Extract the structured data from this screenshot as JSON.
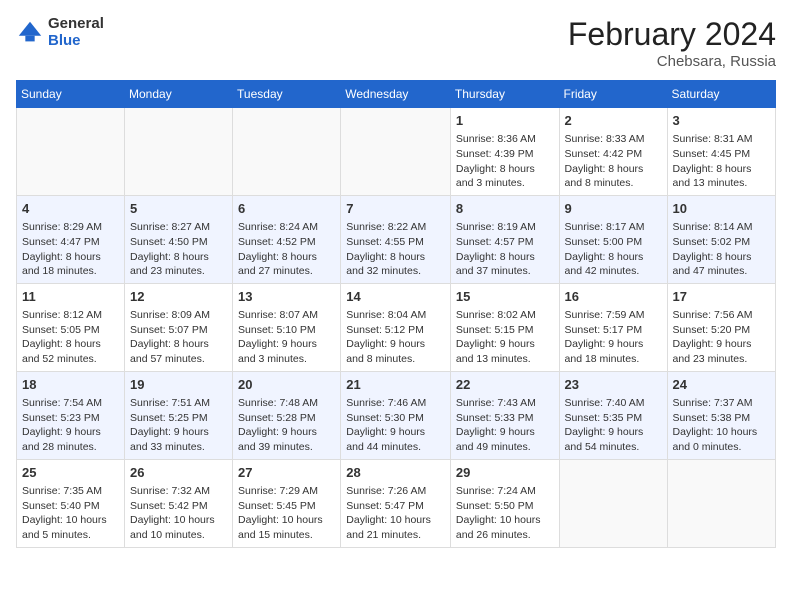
{
  "logo": {
    "general": "General",
    "blue": "Blue"
  },
  "title": {
    "month_year": "February 2024",
    "location": "Chebsara, Russia"
  },
  "weekdays": [
    "Sunday",
    "Monday",
    "Tuesday",
    "Wednesday",
    "Thursday",
    "Friday",
    "Saturday"
  ],
  "weeks": [
    [
      {
        "day": "",
        "text": ""
      },
      {
        "day": "",
        "text": ""
      },
      {
        "day": "",
        "text": ""
      },
      {
        "day": "",
        "text": ""
      },
      {
        "day": "1",
        "text": "Sunrise: 8:36 AM\nSunset: 4:39 PM\nDaylight: 8 hours\nand 3 minutes."
      },
      {
        "day": "2",
        "text": "Sunrise: 8:33 AM\nSunset: 4:42 PM\nDaylight: 8 hours\nand 8 minutes."
      },
      {
        "day": "3",
        "text": "Sunrise: 8:31 AM\nSunset: 4:45 PM\nDaylight: 8 hours\nand 13 minutes."
      }
    ],
    [
      {
        "day": "4",
        "text": "Sunrise: 8:29 AM\nSunset: 4:47 PM\nDaylight: 8 hours\nand 18 minutes."
      },
      {
        "day": "5",
        "text": "Sunrise: 8:27 AM\nSunset: 4:50 PM\nDaylight: 8 hours\nand 23 minutes."
      },
      {
        "day": "6",
        "text": "Sunrise: 8:24 AM\nSunset: 4:52 PM\nDaylight: 8 hours\nand 27 minutes."
      },
      {
        "day": "7",
        "text": "Sunrise: 8:22 AM\nSunset: 4:55 PM\nDaylight: 8 hours\nand 32 minutes."
      },
      {
        "day": "8",
        "text": "Sunrise: 8:19 AM\nSunset: 4:57 PM\nDaylight: 8 hours\nand 37 minutes."
      },
      {
        "day": "9",
        "text": "Sunrise: 8:17 AM\nSunset: 5:00 PM\nDaylight: 8 hours\nand 42 minutes."
      },
      {
        "day": "10",
        "text": "Sunrise: 8:14 AM\nSunset: 5:02 PM\nDaylight: 8 hours\nand 47 minutes."
      }
    ],
    [
      {
        "day": "11",
        "text": "Sunrise: 8:12 AM\nSunset: 5:05 PM\nDaylight: 8 hours\nand 52 minutes."
      },
      {
        "day": "12",
        "text": "Sunrise: 8:09 AM\nSunset: 5:07 PM\nDaylight: 8 hours\nand 57 minutes."
      },
      {
        "day": "13",
        "text": "Sunrise: 8:07 AM\nSunset: 5:10 PM\nDaylight: 9 hours\nand 3 minutes."
      },
      {
        "day": "14",
        "text": "Sunrise: 8:04 AM\nSunset: 5:12 PM\nDaylight: 9 hours\nand 8 minutes."
      },
      {
        "day": "15",
        "text": "Sunrise: 8:02 AM\nSunset: 5:15 PM\nDaylight: 9 hours\nand 13 minutes."
      },
      {
        "day": "16",
        "text": "Sunrise: 7:59 AM\nSunset: 5:17 PM\nDaylight: 9 hours\nand 18 minutes."
      },
      {
        "day": "17",
        "text": "Sunrise: 7:56 AM\nSunset: 5:20 PM\nDaylight: 9 hours\nand 23 minutes."
      }
    ],
    [
      {
        "day": "18",
        "text": "Sunrise: 7:54 AM\nSunset: 5:23 PM\nDaylight: 9 hours\nand 28 minutes."
      },
      {
        "day": "19",
        "text": "Sunrise: 7:51 AM\nSunset: 5:25 PM\nDaylight: 9 hours\nand 33 minutes."
      },
      {
        "day": "20",
        "text": "Sunrise: 7:48 AM\nSunset: 5:28 PM\nDaylight: 9 hours\nand 39 minutes."
      },
      {
        "day": "21",
        "text": "Sunrise: 7:46 AM\nSunset: 5:30 PM\nDaylight: 9 hours\nand 44 minutes."
      },
      {
        "day": "22",
        "text": "Sunrise: 7:43 AM\nSunset: 5:33 PM\nDaylight: 9 hours\nand 49 minutes."
      },
      {
        "day": "23",
        "text": "Sunrise: 7:40 AM\nSunset: 5:35 PM\nDaylight: 9 hours\nand 54 minutes."
      },
      {
        "day": "24",
        "text": "Sunrise: 7:37 AM\nSunset: 5:38 PM\nDaylight: 10 hours\nand 0 minutes."
      }
    ],
    [
      {
        "day": "25",
        "text": "Sunrise: 7:35 AM\nSunset: 5:40 PM\nDaylight: 10 hours\nand 5 minutes."
      },
      {
        "day": "26",
        "text": "Sunrise: 7:32 AM\nSunset: 5:42 PM\nDaylight: 10 hours\nand 10 minutes."
      },
      {
        "day": "27",
        "text": "Sunrise: 7:29 AM\nSunset: 5:45 PM\nDaylight: 10 hours\nand 15 minutes."
      },
      {
        "day": "28",
        "text": "Sunrise: 7:26 AM\nSunset: 5:47 PM\nDaylight: 10 hours\nand 21 minutes."
      },
      {
        "day": "29",
        "text": "Sunrise: 7:24 AM\nSunset: 5:50 PM\nDaylight: 10 hours\nand 26 minutes."
      },
      {
        "day": "",
        "text": ""
      },
      {
        "day": "",
        "text": ""
      }
    ]
  ]
}
